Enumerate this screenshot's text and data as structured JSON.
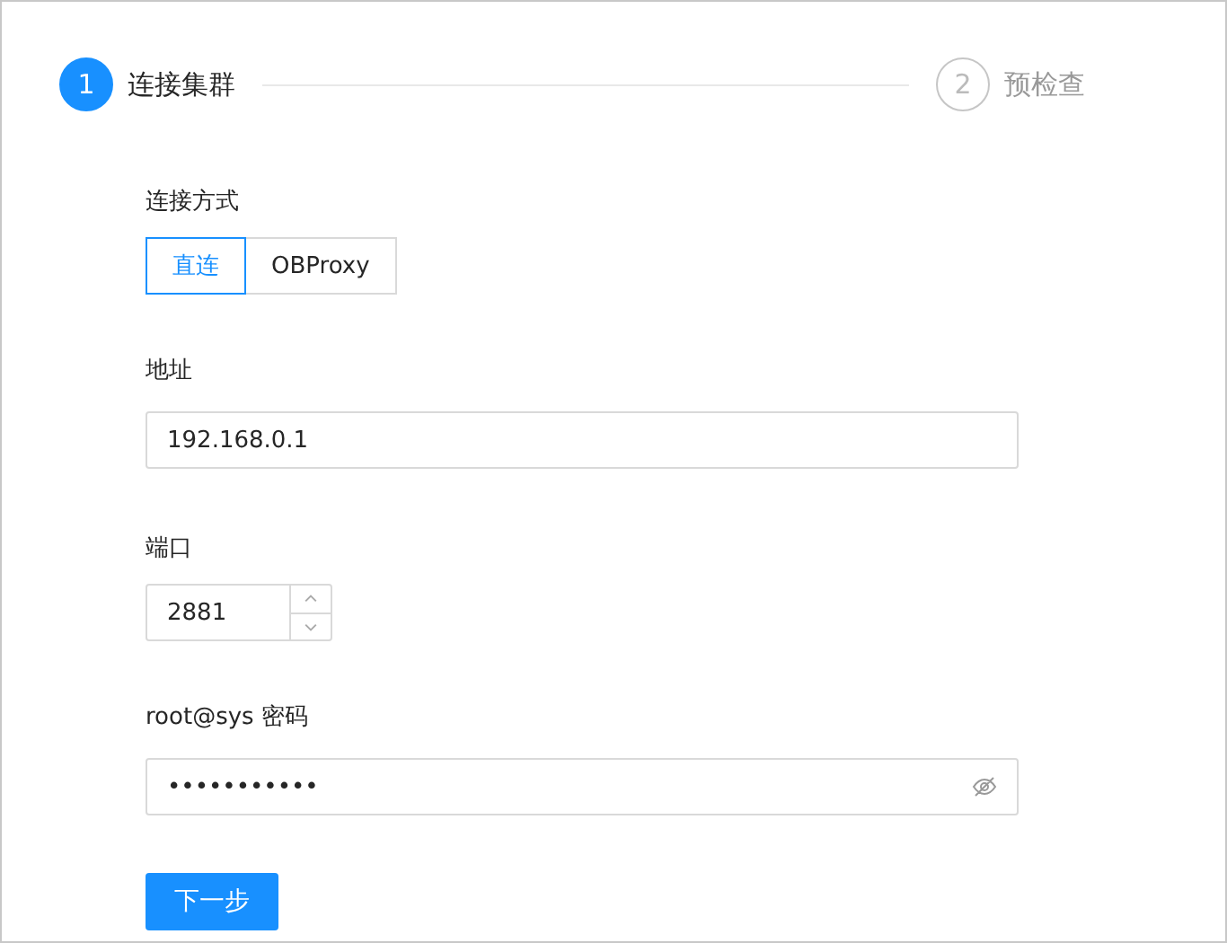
{
  "steps": [
    {
      "number": "1",
      "label": "连接集群",
      "selected": true
    },
    {
      "number": "2",
      "label": "预检查",
      "selected": false
    }
  ],
  "connection": {
    "label": "连接方式",
    "options": [
      {
        "label": "直连",
        "selected": true
      },
      {
        "label": "OBProxy",
        "selected": false
      }
    ]
  },
  "address": {
    "label": "地址",
    "value": "192.168.0.1"
  },
  "port": {
    "label": "端口",
    "value": "2881"
  },
  "password": {
    "label": "root@sys 密码",
    "value": "•••••••••••"
  },
  "next_button": "下一步"
}
